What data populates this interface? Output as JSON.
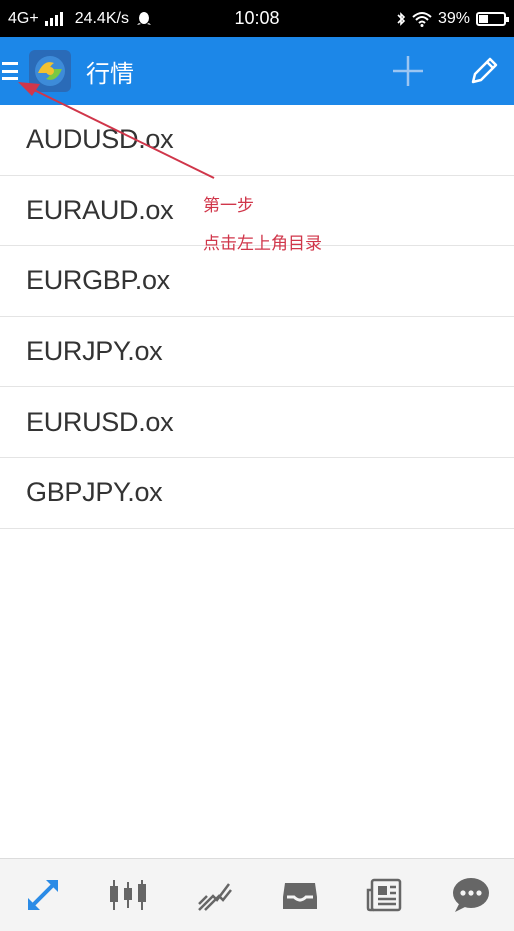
{
  "status_bar": {
    "network": "4G+",
    "speed": "24.4K/s",
    "time": "10:08",
    "battery": "39%",
    "battery_level": 0.39
  },
  "app_bar": {
    "title": "行情",
    "accent_color": "#1c87e8"
  },
  "symbols": [
    {
      "name": "AUDUSD.ox"
    },
    {
      "name": "EURAUD.ox"
    },
    {
      "name": "EURGBP.ox"
    },
    {
      "name": "EURJPY.ox"
    },
    {
      "name": "EURUSD.ox"
    },
    {
      "name": "GBPJPY.ox"
    }
  ],
  "annotation": {
    "step": "第一步",
    "text": "点击左上角目录",
    "color": "#d0364a"
  },
  "bottom_nav": {
    "items": [
      {
        "icon": "quotes-arrows-icon",
        "active": true
      },
      {
        "icon": "candlestick-chart-icon",
        "active": false
      },
      {
        "icon": "trade-icon",
        "active": false
      },
      {
        "icon": "inbox-icon",
        "active": false
      },
      {
        "icon": "news-icon",
        "active": false
      },
      {
        "icon": "chat-icon",
        "active": false
      }
    ]
  }
}
